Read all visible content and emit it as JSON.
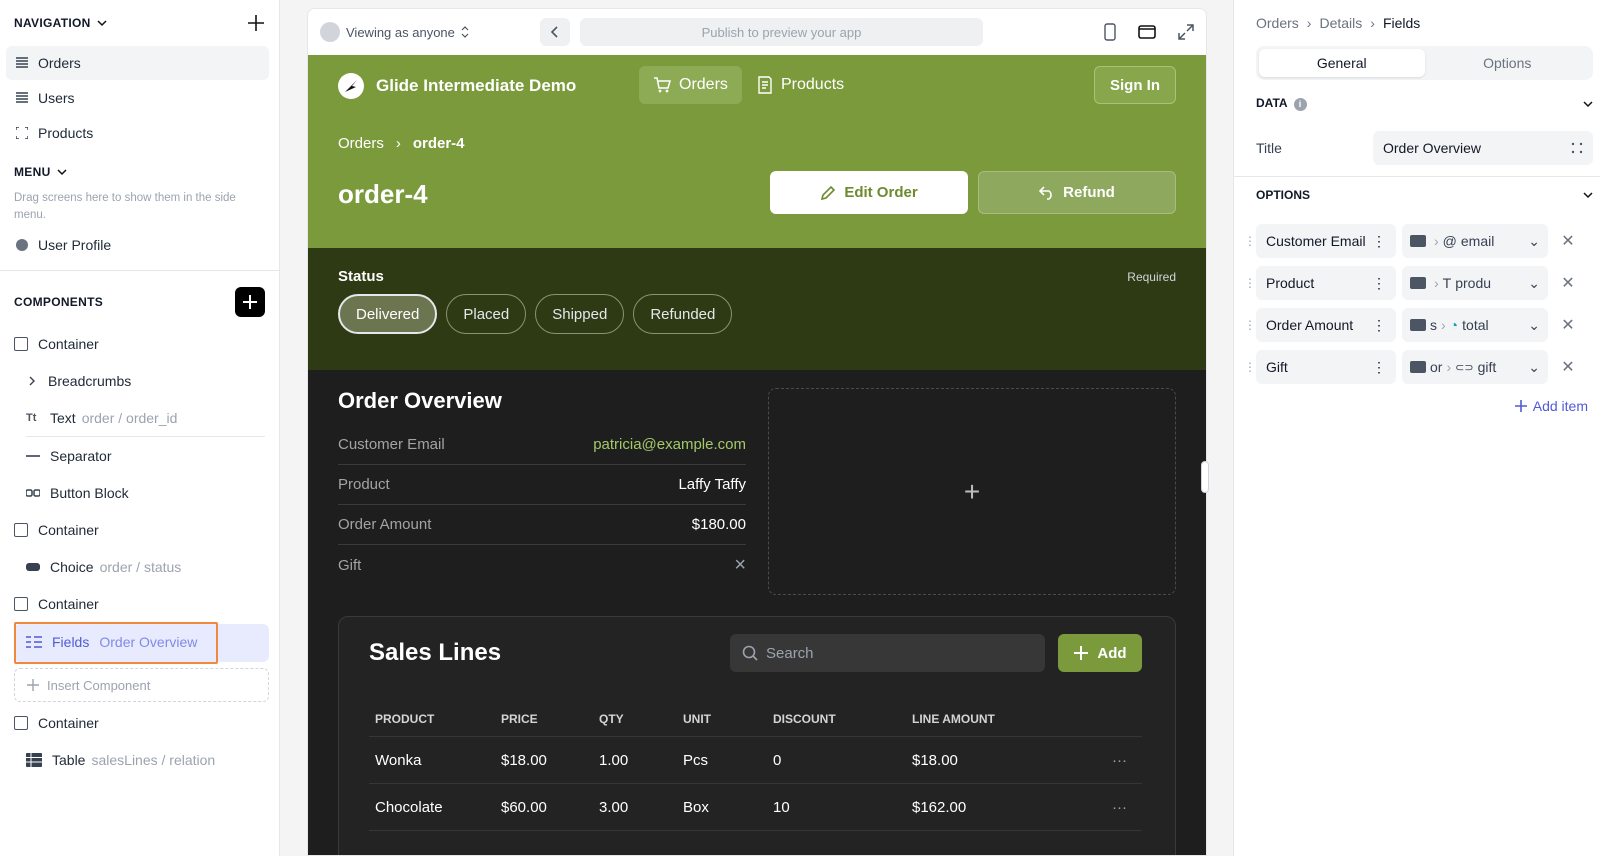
{
  "left": {
    "navigation": {
      "label": "NAVIGATION",
      "items": [
        {
          "label": "Orders",
          "active": true
        },
        {
          "label": "Users",
          "active": false
        },
        {
          "label": "Products",
          "active": false
        }
      ]
    },
    "menu": {
      "label": "MENU",
      "hint": "Drag screens here to show them in the side menu.",
      "items": [
        {
          "label": "User Profile"
        }
      ]
    },
    "components": {
      "label": "COMPONENTS",
      "items": [
        {
          "label": "Container",
          "sub": ""
        },
        {
          "label": "Breadcrumbs",
          "sub": ""
        },
        {
          "label": "Text",
          "sub": "order / order_id",
          "icon_text": "Tt"
        },
        {
          "label": "Separator",
          "sub": ""
        },
        {
          "label": "Button Block",
          "sub": ""
        },
        {
          "label": "Container",
          "sub": ""
        },
        {
          "label": "Choice",
          "sub": "order / status"
        },
        {
          "label": "Container",
          "sub": ""
        },
        {
          "label": "Fields",
          "sub": "Order Overview"
        },
        {
          "label": "Container",
          "sub": ""
        },
        {
          "label": "Table",
          "sub": "salesLines / relation"
        }
      ],
      "insert_label": "Insert Component"
    }
  },
  "preview": {
    "viewing_as": "Viewing as anyone",
    "url_placeholder": "Publish to preview your app",
    "app_name": "Glide Intermediate Demo",
    "tabs": [
      {
        "label": "Orders",
        "active": true
      },
      {
        "label": "Products",
        "active": false
      }
    ],
    "sign_in": "Sign In",
    "breadcrumb": {
      "parent": "Orders",
      "current": "order-4"
    },
    "title": "order-4",
    "edit_label": "Edit Order",
    "refund_label": "Refund",
    "status": {
      "label": "Status",
      "required": "Required",
      "options": [
        {
          "label": "Delivered",
          "selected": true
        },
        {
          "label": "Placed",
          "selected": false
        },
        {
          "label": "Shipped",
          "selected": false
        },
        {
          "label": "Refunded",
          "selected": false
        }
      ]
    },
    "overview": {
      "title": "Order Overview",
      "fields": [
        {
          "key": "Customer Email",
          "value": "patricia@example.com",
          "kind": "link"
        },
        {
          "key": "Product",
          "value": "Laffy Taffy",
          "kind": "text"
        },
        {
          "key": "Order Amount",
          "value": "$180.00",
          "kind": "text"
        },
        {
          "key": "Gift",
          "value": "×",
          "kind": "bool"
        }
      ],
      "drop_plus": "+"
    },
    "sales": {
      "title": "Sales Lines",
      "search_placeholder": "Search",
      "add_label": "Add",
      "columns": [
        "PRODUCT",
        "PRICE",
        "QTY",
        "UNIT",
        "DISCOUNT",
        "LINE AMOUNT"
      ],
      "rows": [
        [
          "Wonka",
          "$18.00",
          "1.00",
          "Pcs",
          "0",
          "$18.00"
        ],
        [
          "Chocolate",
          "$60.00",
          "3.00",
          "Box",
          "10",
          "$162.00"
        ]
      ],
      "row_menu": "···"
    }
  },
  "right": {
    "breadcrumb": [
      "Orders",
      "Details",
      "Fields"
    ],
    "tabs": [
      {
        "label": "General",
        "active": true
      },
      {
        "label": "Options",
        "active": false
      }
    ],
    "data_label": "DATA",
    "title_label": "Title",
    "title_value": "Order Overview",
    "options_label": "OPTIONS",
    "options": [
      {
        "name": "Customer Email",
        "path_prefix": "",
        "path_icon": "@",
        "path_field": "email"
      },
      {
        "name": "Product",
        "path_prefix": "",
        "path_icon": "T",
        "path_field": "produ"
      },
      {
        "name": "Order Amount",
        "path_prefix": "s",
        "path_icon": "◔",
        "path_field": "total"
      },
      {
        "name": "Gift",
        "path_prefix": "or",
        "path_icon": "⊂⊃",
        "path_field": "gift"
      }
    ],
    "add_item": "Add item"
  },
  "colors": {
    "brand_green": "#7b9a3c",
    "status_dark": "#2e3a14",
    "dark_bg": "#1e1e1e",
    "accent_blue": "#4f5bd5",
    "highlight_orange": "#f0883e"
  }
}
